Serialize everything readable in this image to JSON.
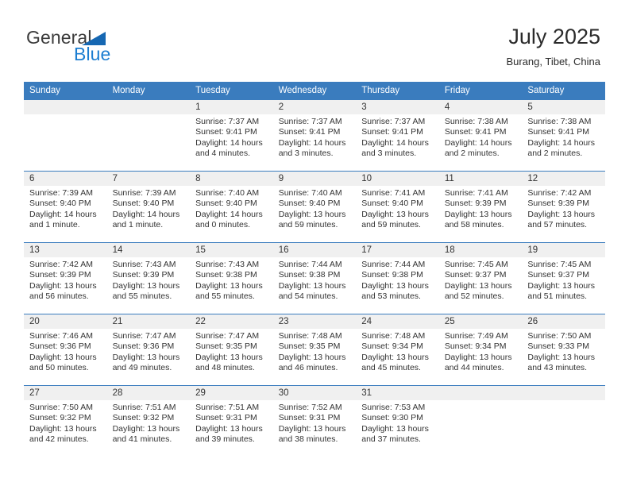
{
  "brand": {
    "name_part1": "General",
    "name_part2": "Blue",
    "accent_color": "#1667b2",
    "blue_text_color": "#1c7ed1"
  },
  "header": {
    "title": "July 2025",
    "location": "Burang, Tibet, China"
  },
  "theme": {
    "header_blue": "#3a7cbe",
    "daynum_band": "#f0f0f0",
    "text": "#333333"
  },
  "weekday_headers": [
    "Sunday",
    "Monday",
    "Tuesday",
    "Wednesday",
    "Thursday",
    "Friday",
    "Saturday"
  ],
  "labels": {
    "sunrise_prefix": "Sunrise:",
    "sunset_prefix": "Sunset:",
    "daylight_prefix": "Daylight:"
  },
  "weeks": [
    [
      {
        "day": "",
        "sunrise": "",
        "sunset": "",
        "daylight_line1": "",
        "daylight_line2": ""
      },
      {
        "day": "",
        "sunrise": "",
        "sunset": "",
        "daylight_line1": "",
        "daylight_line2": ""
      },
      {
        "day": "1",
        "sunrise": "Sunrise: 7:37 AM",
        "sunset": "Sunset: 9:41 PM",
        "daylight_line1": "Daylight: 14 hours",
        "daylight_line2": "and 4 minutes."
      },
      {
        "day": "2",
        "sunrise": "Sunrise: 7:37 AM",
        "sunset": "Sunset: 9:41 PM",
        "daylight_line1": "Daylight: 14 hours",
        "daylight_line2": "and 3 minutes."
      },
      {
        "day": "3",
        "sunrise": "Sunrise: 7:37 AM",
        "sunset": "Sunset: 9:41 PM",
        "daylight_line1": "Daylight: 14 hours",
        "daylight_line2": "and 3 minutes."
      },
      {
        "day": "4",
        "sunrise": "Sunrise: 7:38 AM",
        "sunset": "Sunset: 9:41 PM",
        "daylight_line1": "Daylight: 14 hours",
        "daylight_line2": "and 2 minutes."
      },
      {
        "day": "5",
        "sunrise": "Sunrise: 7:38 AM",
        "sunset": "Sunset: 9:41 PM",
        "daylight_line1": "Daylight: 14 hours",
        "daylight_line2": "and 2 minutes."
      }
    ],
    [
      {
        "day": "6",
        "sunrise": "Sunrise: 7:39 AM",
        "sunset": "Sunset: 9:40 PM",
        "daylight_line1": "Daylight: 14 hours",
        "daylight_line2": "and 1 minute."
      },
      {
        "day": "7",
        "sunrise": "Sunrise: 7:39 AM",
        "sunset": "Sunset: 9:40 PM",
        "daylight_line1": "Daylight: 14 hours",
        "daylight_line2": "and 1 minute."
      },
      {
        "day": "8",
        "sunrise": "Sunrise: 7:40 AM",
        "sunset": "Sunset: 9:40 PM",
        "daylight_line1": "Daylight: 14 hours",
        "daylight_line2": "and 0 minutes."
      },
      {
        "day": "9",
        "sunrise": "Sunrise: 7:40 AM",
        "sunset": "Sunset: 9:40 PM",
        "daylight_line1": "Daylight: 13 hours",
        "daylight_line2": "and 59 minutes."
      },
      {
        "day": "10",
        "sunrise": "Sunrise: 7:41 AM",
        "sunset": "Sunset: 9:40 PM",
        "daylight_line1": "Daylight: 13 hours",
        "daylight_line2": "and 59 minutes."
      },
      {
        "day": "11",
        "sunrise": "Sunrise: 7:41 AM",
        "sunset": "Sunset: 9:39 PM",
        "daylight_line1": "Daylight: 13 hours",
        "daylight_line2": "and 58 minutes."
      },
      {
        "day": "12",
        "sunrise": "Sunrise: 7:42 AM",
        "sunset": "Sunset: 9:39 PM",
        "daylight_line1": "Daylight: 13 hours",
        "daylight_line2": "and 57 minutes."
      }
    ],
    [
      {
        "day": "13",
        "sunrise": "Sunrise: 7:42 AM",
        "sunset": "Sunset: 9:39 PM",
        "daylight_line1": "Daylight: 13 hours",
        "daylight_line2": "and 56 minutes."
      },
      {
        "day": "14",
        "sunrise": "Sunrise: 7:43 AM",
        "sunset": "Sunset: 9:39 PM",
        "daylight_line1": "Daylight: 13 hours",
        "daylight_line2": "and 55 minutes."
      },
      {
        "day": "15",
        "sunrise": "Sunrise: 7:43 AM",
        "sunset": "Sunset: 9:38 PM",
        "daylight_line1": "Daylight: 13 hours",
        "daylight_line2": "and 55 minutes."
      },
      {
        "day": "16",
        "sunrise": "Sunrise: 7:44 AM",
        "sunset": "Sunset: 9:38 PM",
        "daylight_line1": "Daylight: 13 hours",
        "daylight_line2": "and 54 minutes."
      },
      {
        "day": "17",
        "sunrise": "Sunrise: 7:44 AM",
        "sunset": "Sunset: 9:38 PM",
        "daylight_line1": "Daylight: 13 hours",
        "daylight_line2": "and 53 minutes."
      },
      {
        "day": "18",
        "sunrise": "Sunrise: 7:45 AM",
        "sunset": "Sunset: 9:37 PM",
        "daylight_line1": "Daylight: 13 hours",
        "daylight_line2": "and 52 minutes."
      },
      {
        "day": "19",
        "sunrise": "Sunrise: 7:45 AM",
        "sunset": "Sunset: 9:37 PM",
        "daylight_line1": "Daylight: 13 hours",
        "daylight_line2": "and 51 minutes."
      }
    ],
    [
      {
        "day": "20",
        "sunrise": "Sunrise: 7:46 AM",
        "sunset": "Sunset: 9:36 PM",
        "daylight_line1": "Daylight: 13 hours",
        "daylight_line2": "and 50 minutes."
      },
      {
        "day": "21",
        "sunrise": "Sunrise: 7:47 AM",
        "sunset": "Sunset: 9:36 PM",
        "daylight_line1": "Daylight: 13 hours",
        "daylight_line2": "and 49 minutes."
      },
      {
        "day": "22",
        "sunrise": "Sunrise: 7:47 AM",
        "sunset": "Sunset: 9:35 PM",
        "daylight_line1": "Daylight: 13 hours",
        "daylight_line2": "and 48 minutes."
      },
      {
        "day": "23",
        "sunrise": "Sunrise: 7:48 AM",
        "sunset": "Sunset: 9:35 PM",
        "daylight_line1": "Daylight: 13 hours",
        "daylight_line2": "and 46 minutes."
      },
      {
        "day": "24",
        "sunrise": "Sunrise: 7:48 AM",
        "sunset": "Sunset: 9:34 PM",
        "daylight_line1": "Daylight: 13 hours",
        "daylight_line2": "and 45 minutes."
      },
      {
        "day": "25",
        "sunrise": "Sunrise: 7:49 AM",
        "sunset": "Sunset: 9:34 PM",
        "daylight_line1": "Daylight: 13 hours",
        "daylight_line2": "and 44 minutes."
      },
      {
        "day": "26",
        "sunrise": "Sunrise: 7:50 AM",
        "sunset": "Sunset: 9:33 PM",
        "daylight_line1": "Daylight: 13 hours",
        "daylight_line2": "and 43 minutes."
      }
    ],
    [
      {
        "day": "27",
        "sunrise": "Sunrise: 7:50 AM",
        "sunset": "Sunset: 9:32 PM",
        "daylight_line1": "Daylight: 13 hours",
        "daylight_line2": "and 42 minutes."
      },
      {
        "day": "28",
        "sunrise": "Sunrise: 7:51 AM",
        "sunset": "Sunset: 9:32 PM",
        "daylight_line1": "Daylight: 13 hours",
        "daylight_line2": "and 41 minutes."
      },
      {
        "day": "29",
        "sunrise": "Sunrise: 7:51 AM",
        "sunset": "Sunset: 9:31 PM",
        "daylight_line1": "Daylight: 13 hours",
        "daylight_line2": "and 39 minutes."
      },
      {
        "day": "30",
        "sunrise": "Sunrise: 7:52 AM",
        "sunset": "Sunset: 9:31 PM",
        "daylight_line1": "Daylight: 13 hours",
        "daylight_line2": "and 38 minutes."
      },
      {
        "day": "31",
        "sunrise": "Sunrise: 7:53 AM",
        "sunset": "Sunset: 9:30 PM",
        "daylight_line1": "Daylight: 13 hours",
        "daylight_line2": "and 37 minutes."
      },
      {
        "day": "",
        "sunrise": "",
        "sunset": "",
        "daylight_line1": "",
        "daylight_line2": ""
      },
      {
        "day": "",
        "sunrise": "",
        "sunset": "",
        "daylight_line1": "",
        "daylight_line2": ""
      }
    ]
  ]
}
